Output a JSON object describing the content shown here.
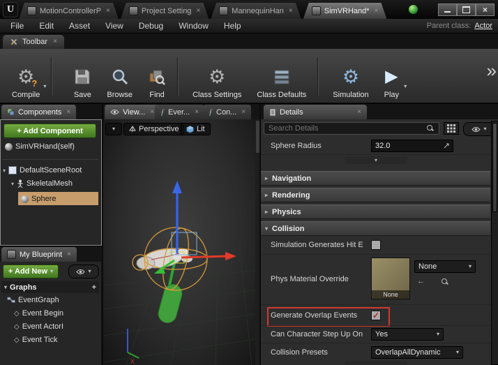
{
  "colors": {
    "accent_green": "#4e8e27",
    "selection_tan": "#c79d6c",
    "highlight_red": "#d23a30",
    "gizmo_blue": "#3a66e8",
    "gizmo_red": "#e23a2a",
    "gizmo_green": "#35c035",
    "wireframe_orange": "#d9993a"
  },
  "titlebar": {
    "tabs": [
      {
        "label": "MotionControllerP"
      },
      {
        "label": "Project Setting"
      },
      {
        "label": "MannequinHan"
      },
      {
        "label": "SimVRHand*"
      }
    ]
  },
  "menubar": {
    "items": [
      "File",
      "Edit",
      "Asset",
      "View",
      "Debug",
      "Window",
      "Help"
    ],
    "parent_class_label": "Parent class:",
    "parent_class_value": "Actor"
  },
  "toolbar": {
    "tab_label": "Toolbar",
    "buttons": [
      {
        "label": "Compile"
      },
      {
        "label": "Save"
      },
      {
        "label": "Browse"
      },
      {
        "label": "Find"
      },
      {
        "label": "Class Settings"
      },
      {
        "label": "Class Defaults"
      },
      {
        "label": "Simulation"
      },
      {
        "label": "Play"
      }
    ]
  },
  "components": {
    "tab_label": "Components",
    "add_label": "+ Add Component",
    "tree": [
      {
        "label": "SimVRHand(self)"
      },
      {
        "label": "DefaultSceneRoot"
      },
      {
        "label": "SkeletalMesh"
      },
      {
        "label": "Sphere",
        "selected": true
      }
    ]
  },
  "my_blueprint": {
    "tab_label": "My Blueprint",
    "add_label": "+ Add New",
    "graphs_label": "Graphs",
    "items": [
      {
        "label": "EventGraph"
      },
      {
        "label": "Event Begin"
      },
      {
        "label": "Event ActorI"
      },
      {
        "label": "Event Tick"
      }
    ]
  },
  "viewport": {
    "tabs": [
      {
        "label": "View...",
        "active": true
      },
      {
        "label": "Ever..."
      },
      {
        "label": "Con..."
      }
    ],
    "perspective_label": "Perspective",
    "lit_label": "Lit"
  },
  "details": {
    "tab_label": "Details",
    "search_placeholder": "Search Details",
    "sphere_radius_label": "Sphere Radius",
    "sphere_radius_value": "32.0",
    "categories": [
      {
        "label": "Navigation",
        "expanded": false
      },
      {
        "label": "Rendering",
        "expanded": false
      },
      {
        "label": "Physics",
        "expanded": false
      },
      {
        "label": "Collision",
        "expanded": true
      }
    ],
    "collision": {
      "sim_hit_label": "Simulation Generates Hit E",
      "sim_hit_checked": false,
      "phys_label": "Phys Material Override",
      "phys_thumb_label": "None",
      "phys_value": "None",
      "overlap_label": "Generate Overlap Events",
      "overlap_checked": true,
      "overlap_check_glyph": "✓",
      "step_label": "Can Character Step Up On",
      "step_value": "Yes",
      "presets_label": "Collision Presets",
      "presets_value": "OverlapAllDynamic"
    }
  }
}
